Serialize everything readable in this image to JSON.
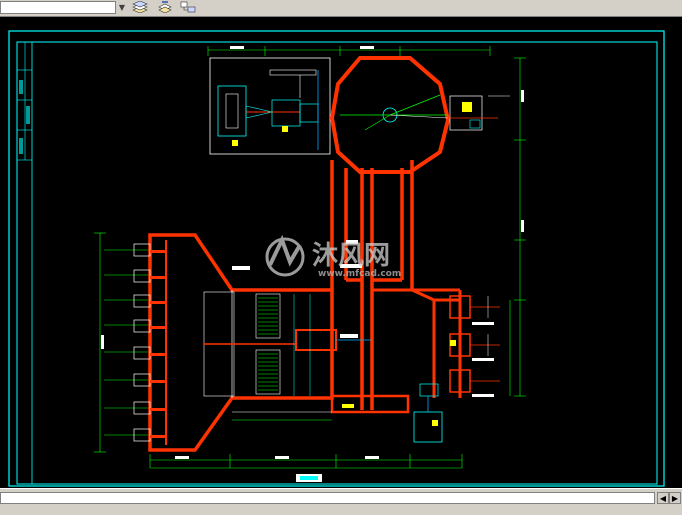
{
  "toolbar": {
    "layer_field_value": "",
    "icons": [
      "layer-state-icon",
      "layer-previous-icon",
      "layer-match-icon"
    ]
  },
  "watermark": {
    "brand": "沐风网",
    "url": "www.mfcad.com"
  },
  "statusbar": {
    "scroll_left_icon": "triangle-left",
    "scroll_right_icon": "triangle-right"
  },
  "colors": {
    "background": "#000000",
    "frame": "#00ffff",
    "walls": "#ff3300",
    "dimensions": "#00ff00",
    "outlines": "#ffffff",
    "annotations": "#ffff00",
    "pipes": "#00aaff"
  }
}
